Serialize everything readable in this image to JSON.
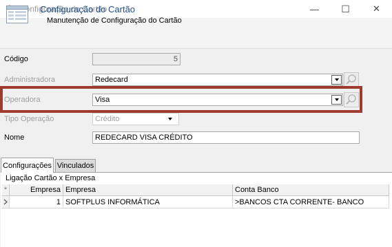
{
  "window": {
    "title": "Configuração do Cartão",
    "minimize": "—",
    "maximize": "☐",
    "close": "✕"
  },
  "header": {
    "title": "Configuração do Cartão",
    "subtitle": "Manutenção de Configuração do Cartão"
  },
  "form": {
    "codigo": {
      "label": "Código",
      "value": "5"
    },
    "administradora": {
      "label": "Administradora",
      "value": "Redecard"
    },
    "operadora": {
      "label": "Operadora",
      "value": "Visa"
    },
    "tipo_operacao": {
      "label": "Tipo Operação",
      "value": "Crédito"
    },
    "nome": {
      "label": "Nome",
      "value": "REDECARD VISA CRÉDITO"
    }
  },
  "tabs": [
    {
      "label": "Configurações",
      "active": true
    },
    {
      "label": "Vinculados",
      "active": false
    }
  ],
  "grid": {
    "caption": "Ligação Cartão x Empresa",
    "columns": [
      "Empresa",
      "Empresa",
      "Conta Banco"
    ],
    "rows": [
      {
        "empresa_id": "1",
        "empresa": "SOFTPLUS INFORMÁTICA",
        "conta_banco": ">BANCOS CTA CORRENTE- BANCO"
      }
    ]
  },
  "colors": {
    "highlight": "#9e3a2e",
    "header_title": "#1e4e8c"
  },
  "icons": [
    "app-icon",
    "form-icon",
    "search-icon",
    "chevron-down-icon",
    "row-pointer-icon",
    "asterisk-icon"
  ]
}
